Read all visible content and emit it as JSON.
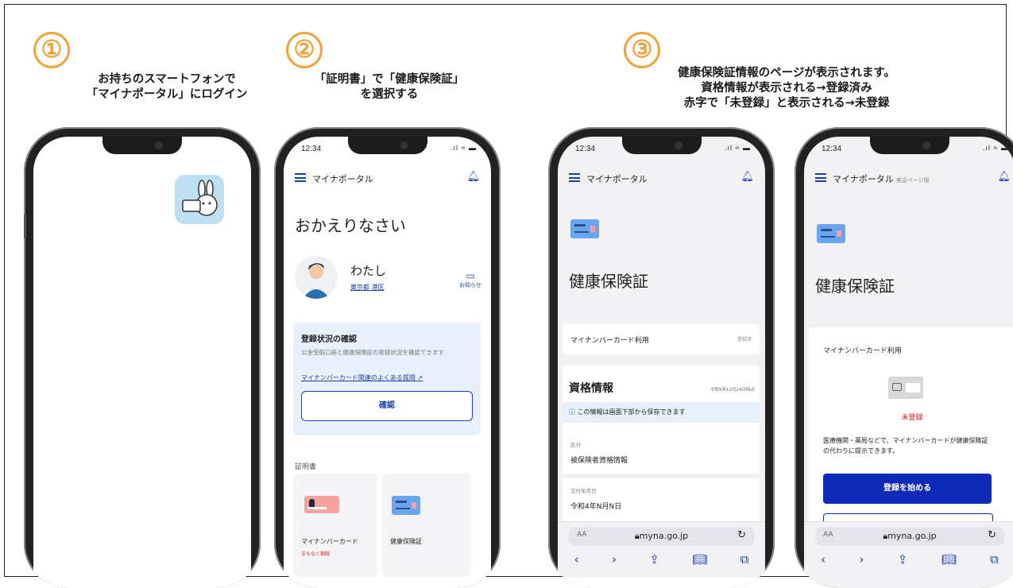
{
  "steps": [
    {
      "number": "①",
      "caption_lines": [
        "お持ちのスマートフォンで",
        "「マイナポータル」にログイン"
      ]
    },
    {
      "number": "②",
      "caption_lines": [
        "「証明書」で「健康保険証」",
        "を選択する"
      ]
    },
    {
      "number": "③",
      "caption_lines": [
        "健康保険証情報のページが表示されます。",
        "資格情報が表示される→登録済み",
        "赤字で「未登録」と表示される→未登録"
      ]
    }
  ],
  "phone2": {
    "time": "12:34",
    "app_name": "マイナポータル",
    "greeting": "おかえりなさい",
    "user_name": "わたし",
    "user_location": "東京都 港区",
    "notice_label": "お知らせ",
    "reg_title": "登録状況の確認",
    "reg_desc": "公金受取口座と健康保険証の登録状況を確認できます",
    "reg_link": "マイナンバーカード関連のよくある質問",
    "reg_button": "確認",
    "certs_heading": "証明書",
    "cert_card1_label": "マイナンバーカード",
    "cert_card1_sub": "まもなく期限",
    "cert_card2_label": "健康保険証"
  },
  "phone3": {
    "time": "12:34",
    "app_name": "マイナポータル",
    "page_title": "健康保険証",
    "usage_label": "マイナンバーカード利用",
    "usage_status": "登録済",
    "qual_title": "資格情報",
    "qual_date": "令和5年12月24日時点",
    "info_banner": "この情報は画面下部から保存できます",
    "field1_label": "区分",
    "field1_value": "被保険者資格情報",
    "field2_label": "交付年月日",
    "field2_value": "令和4年N月N日",
    "url": "myna.go.jp",
    "aa": "AA"
  },
  "phone4": {
    "time": "12:34",
    "app_name": "マイナポータル",
    "app_tag": "実証ページ版",
    "page_title": "健康保険証",
    "usage_label": "マイナンバーカード利用",
    "unregistered": "未登録",
    "desc": "医療機関・薬局などで、マイナンバーカードが健康保険証の代わりに提示できます。",
    "start_button": "登録を始める",
    "url": "myna.go.jp",
    "aa": "AA"
  },
  "colors": {
    "accent": "#f0a33a",
    "brand": "#1a3fa8",
    "alert": "#e02020"
  }
}
